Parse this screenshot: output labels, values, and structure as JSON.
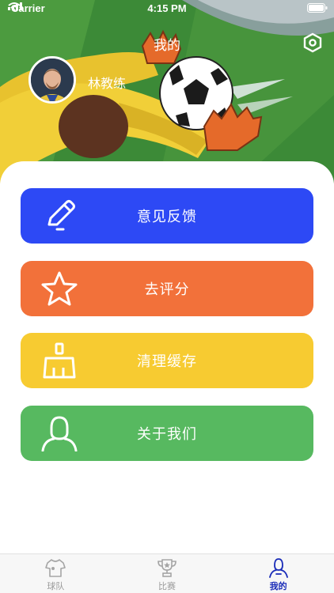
{
  "status_bar": {
    "carrier": "Carrier",
    "time": "4:15 PM"
  },
  "header": {
    "title": "我的",
    "user_name": "林教练"
  },
  "menu": {
    "feedback": {
      "label": "意见反馈",
      "icon": "pencil-icon",
      "color": "#2d49f5"
    },
    "rate": {
      "label": "去评分",
      "icon": "star-icon",
      "color": "#f2713a"
    },
    "cache": {
      "label": "清理缓存",
      "icon": "broom-icon",
      "color": "#f7cb31"
    },
    "about": {
      "label": "关于我们",
      "icon": "person-icon",
      "color": "#57b960"
    }
  },
  "tabbar": {
    "tabs": [
      {
        "label": "球队",
        "icon": "jersey-icon",
        "active": false
      },
      {
        "label": "比赛",
        "icon": "trophy-icon",
        "active": false
      },
      {
        "label": "我的",
        "icon": "profile-icon",
        "active": true
      }
    ],
    "active_color": "#1a2cb8"
  }
}
